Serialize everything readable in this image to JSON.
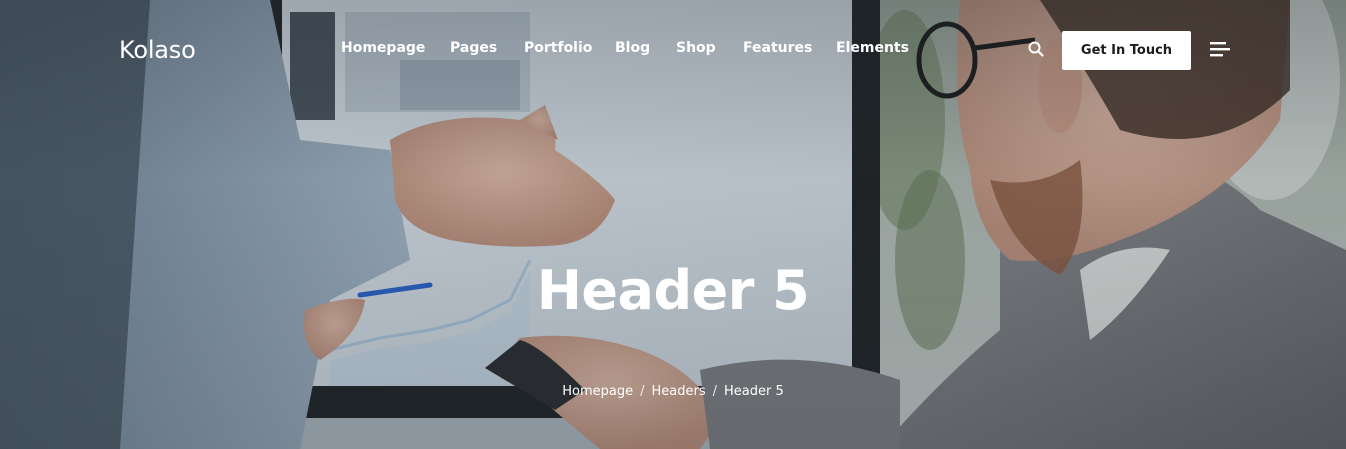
{
  "brand": {
    "name": "Kolaso"
  },
  "nav": {
    "items": [
      {
        "label": "Homepage"
      },
      {
        "label": "Pages"
      },
      {
        "label": "Portfolio"
      },
      {
        "label": "Blog"
      },
      {
        "label": "Shop"
      },
      {
        "label": "Features"
      },
      {
        "label": "Elements"
      }
    ]
  },
  "header_actions": {
    "search_icon": "search-icon",
    "cta_label": "Get In Touch",
    "menu_icon": "hamburger-menu-icon"
  },
  "page": {
    "title": "Header 5"
  },
  "breadcrumb": {
    "items": [
      "Homepage",
      "Headers",
      "Header 5"
    ],
    "separator": "/"
  },
  "colors": {
    "text": "#ffffff",
    "button_bg": "#ffffff",
    "button_text": "#1c1c1c"
  }
}
